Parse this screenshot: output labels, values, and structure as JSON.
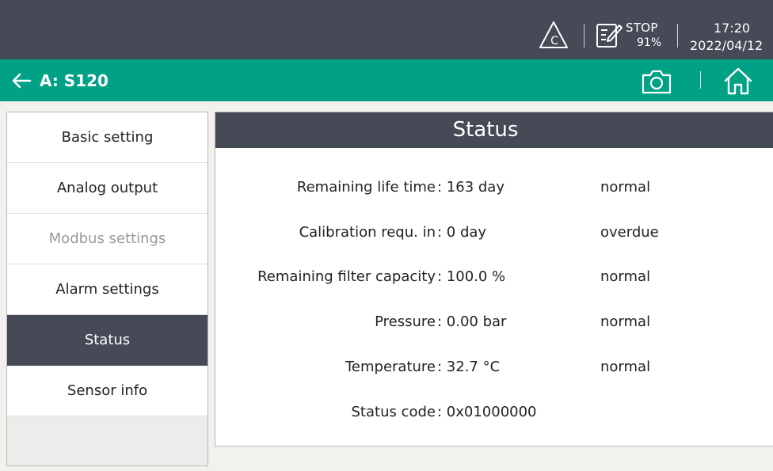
{
  "topbar": {
    "warning_icon": "warning-triangle-c-icon",
    "edit_icon": "edit-note-icon",
    "run_state": "STOP",
    "percent": "91%",
    "time": "17:20",
    "date": "2022/04/12"
  },
  "header": {
    "back_icon": "arrow-left-icon",
    "title": "A: S120",
    "camera_icon": "camera-icon",
    "home_icon": "home-icon",
    "accent_color": "#00a184"
  },
  "sidebar": {
    "items": [
      {
        "label": "Basic setting",
        "state": "normal"
      },
      {
        "label": "Analog output",
        "state": "normal"
      },
      {
        "label": "Modbus settings",
        "state": "disabled"
      },
      {
        "label": "Alarm settings",
        "state": "normal"
      },
      {
        "label": "Status",
        "state": "active"
      },
      {
        "label": "Sensor info",
        "state": "normal"
      }
    ]
  },
  "main": {
    "title": "Status",
    "rows": [
      {
        "label": "Remaining life time",
        "value": ": 163 day",
        "status": "normal"
      },
      {
        "label": "Calibration requ. in",
        "value": ": 0 day",
        "status": "overdue"
      },
      {
        "label": "Remaining filter capacity",
        "value": ": 100.0 %",
        "status": "normal"
      },
      {
        "label": "Pressure",
        "value": ": 0.00 bar",
        "status": "normal"
      },
      {
        "label": "Temperature",
        "value": ": 32.7 °C",
        "status": "normal"
      },
      {
        "label": "Status code",
        "value": ": 0x01000000",
        "status": ""
      }
    ]
  }
}
